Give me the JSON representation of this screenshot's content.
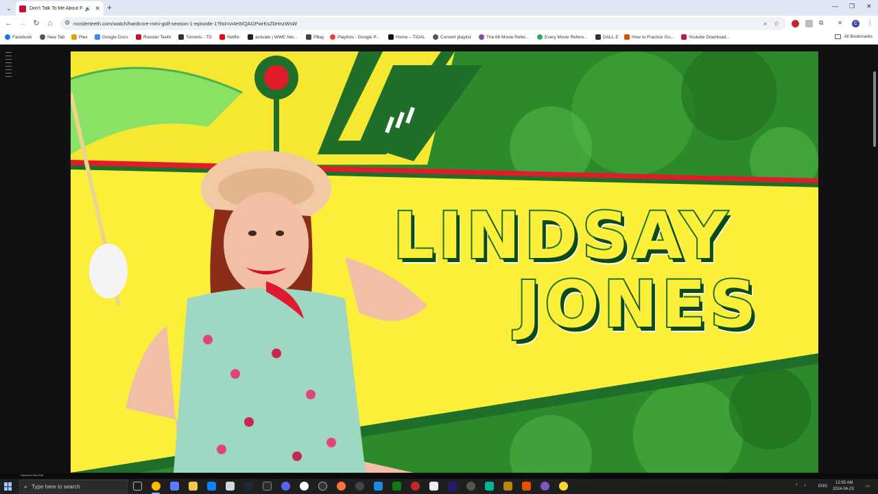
{
  "browser": {
    "tab": {
      "title": "Don't Talk To Me About Fr",
      "audio_icon": "speaker-icon",
      "close_icon": "close-icon"
    },
    "url": "roosterteeth.com/watch/hardcore-mini-golf-season-1-episode-1?list=vi4eWQAGPwrKsZbHnzWsW",
    "bookmarks": [
      {
        "label": "Facebook",
        "color": "#1877f2"
      },
      {
        "label": "New Tab",
        "color": "#555555"
      },
      {
        "label": "Plex",
        "color": "#e5a00d"
      },
      {
        "label": "Google Docs",
        "color": "#4285f4"
      },
      {
        "label": "Rooster Teeth",
        "color": "#c8102e"
      },
      {
        "label": "Torrents - TD",
        "color": "#333333"
      },
      {
        "label": "Netflix",
        "color": "#e50914"
      },
      {
        "label": "activate | WWE Net...",
        "color": "#222222"
      },
      {
        "label": "PBay",
        "color": "#444444"
      },
      {
        "label": "Playlists - Google P...",
        "color": "#ea4335"
      },
      {
        "label": "Home – TIDAL",
        "color": "#111111"
      },
      {
        "label": "Convert playlist",
        "color": "#555555"
      },
      {
        "label": "The 68 Movie Refer...",
        "color": "#8e44ad"
      },
      {
        "label": "Every Movie Refere...",
        "color": "#27ae60"
      },
      {
        "label": "DALL·E",
        "color": "#333333"
      },
      {
        "label": "How to Practice Gu...",
        "color": "#d35400"
      },
      {
        "label": "Youtube Download...",
        "color": "#c2185b"
      }
    ],
    "all_bookmarks": "All Bookmarks",
    "profile_initial": "C"
  },
  "video": {
    "first_name": "LINDSAY",
    "last_name": "JONES",
    "strip_label": "Hardcore Mini Golf",
    "colors": {
      "yellow": "#fbef3a",
      "dark_green": "#1f6e2a",
      "red": "#e01b2a"
    }
  },
  "taskbar": {
    "search_placeholder": "Type here to search",
    "language": "ENG",
    "time": "12:55 AM",
    "date": "2024-04-23"
  }
}
